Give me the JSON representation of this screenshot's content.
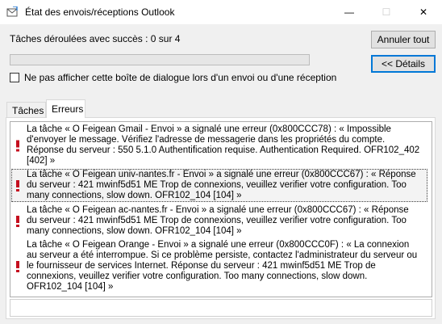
{
  "window": {
    "title": "État des envois/réceptions Outlook",
    "controls": {
      "minimize": "—",
      "maximize": "☐",
      "close": "✕"
    }
  },
  "status_text": "Tâches déroulées avec succès : 0 sur 4",
  "progress": {
    "value": 0
  },
  "buttons": {
    "cancel_all": "Annuler tout",
    "details": "<< Détails"
  },
  "checkbox": {
    "label": "Ne pas afficher cette boîte de dialogue lors d'un envoi ou d'une réception",
    "checked": false
  },
  "tabs": [
    {
      "label": "Tâches"
    },
    {
      "label": "Erreurs"
    }
  ],
  "errors": [
    {
      "text": "La tâche « O Feigean Gmail - Envoi » a signalé une erreur (0x800CCC78) : « Impossible d'envoyer le message. Vérifiez l'adresse de messagerie dans les propriétés du compte. Réponse du serveur : 550 5.1.0 Authentification requise. Authentication Required. OFR102_402 [402] »"
    },
    {
      "text": "La tâche « O Feigean univ-nantes.fr - Envoi » a signalé une erreur (0x800CCC67) : «    Réponse du serveur : 421 mwinf5d51 ME Trop de connexions, veuillez verifier votre configuration. Too many connections, slow down. OFR102_104 [104] »"
    },
    {
      "text": "La tâche « O Feigean ac-nantes.fr - Envoi » a signalé une erreur (0x800CCC67) : «    Réponse du serveur : 421 mwinf5d51 ME Trop de connexions, veuillez verifier votre configuration. Too many connections, slow down. OFR102_104 [104] »"
    },
    {
      "text": "La tâche « O Feigean Orange - Envoi » a signalé une erreur (0x800CCC0F) : « La connexion au serveur a été interrompue. Si ce problème persiste, contactez l'administrateur du serveur ou le fournisseur de services Internet.  Réponse du serveur : 421 mwinf5d51 ME Trop de connexions, veuillez verifier votre configuration. Too many connections, slow down. OFR102_104 [104] »"
    }
  ],
  "colors": {
    "accent": "#0078d7",
    "error_red": "#c50f1f",
    "selected_bg": "#f3f3f3"
  }
}
